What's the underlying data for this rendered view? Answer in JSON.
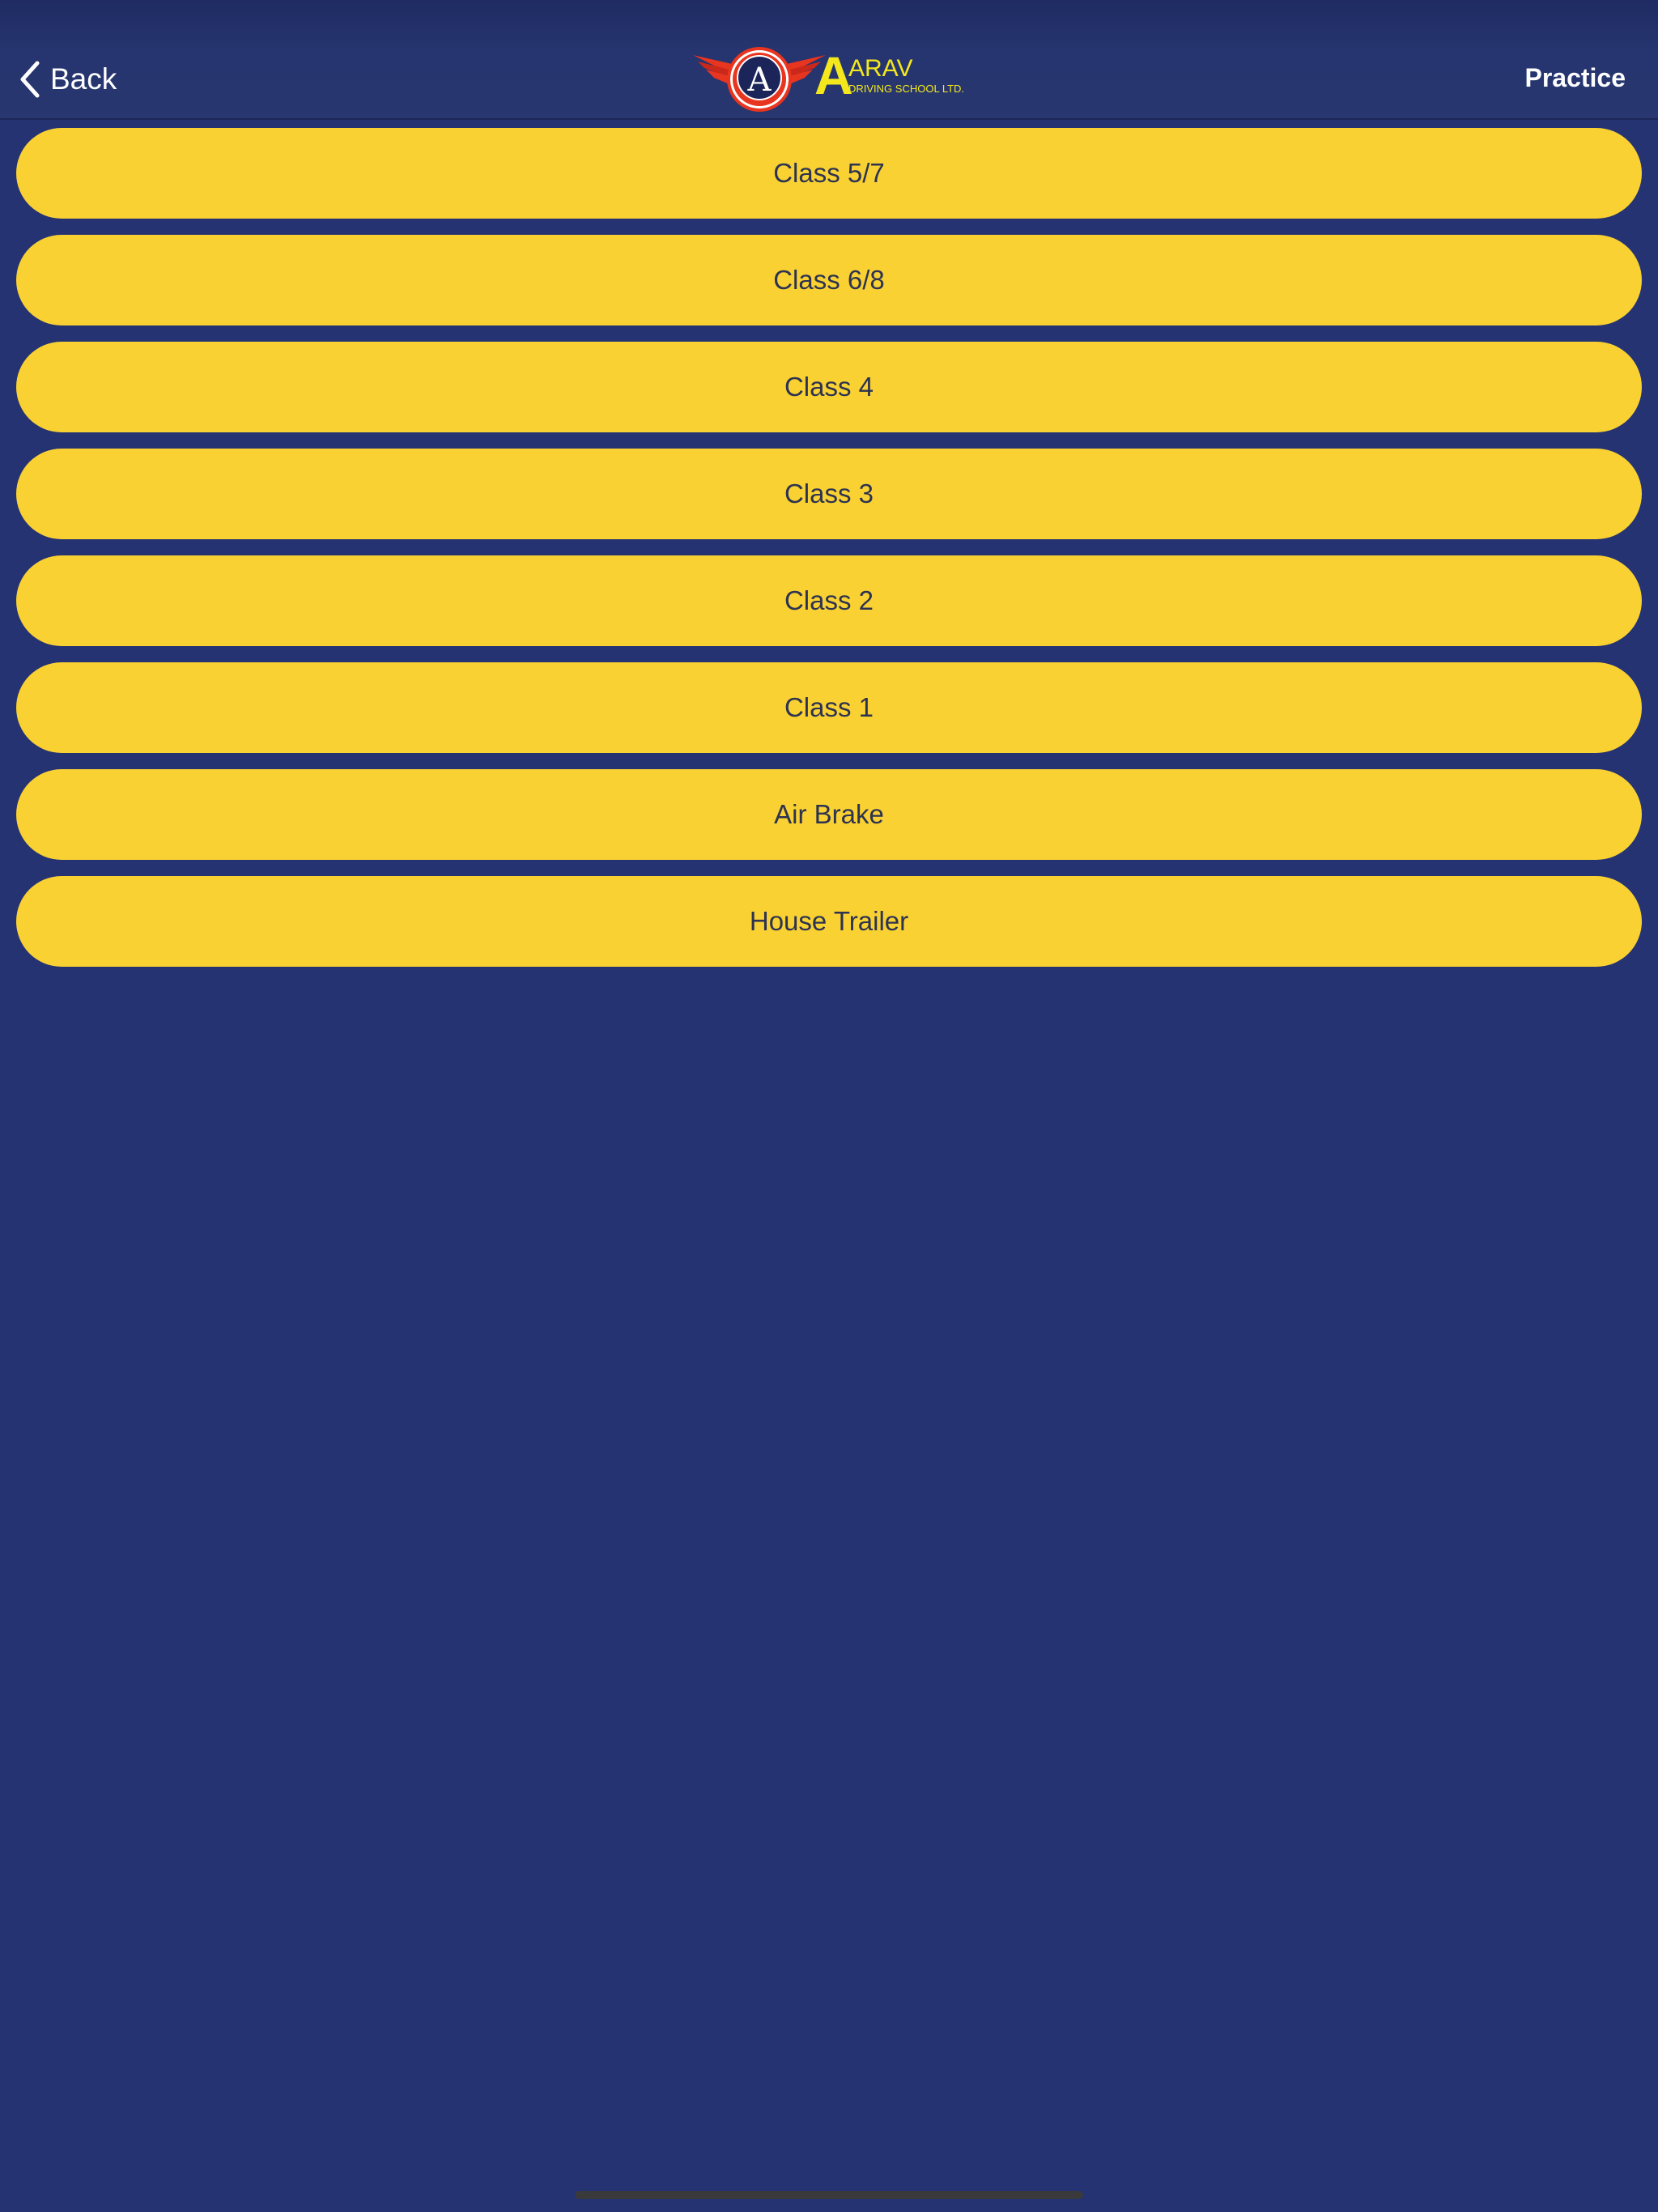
{
  "navbar": {
    "back_label": "Back",
    "title": "Practice",
    "logo": {
      "big_letter": "A",
      "brand": "ARAV",
      "tagline": "DRIVING SCHOOL LTD.",
      "emblem_letter": "A"
    }
  },
  "classes": [
    {
      "label": "Class 5/7"
    },
    {
      "label": "Class 6/8"
    },
    {
      "label": "Class 4"
    },
    {
      "label": "Class 3"
    },
    {
      "label": "Class 2"
    },
    {
      "label": "Class 1"
    },
    {
      "label": "Air Brake"
    },
    {
      "label": "House Trailer"
    }
  ],
  "colors": {
    "background": "#253373",
    "button": "#f9d133",
    "button_text": "#2d3350",
    "logo_yellow": "#f4e81c",
    "logo_red": "#e8351f"
  }
}
